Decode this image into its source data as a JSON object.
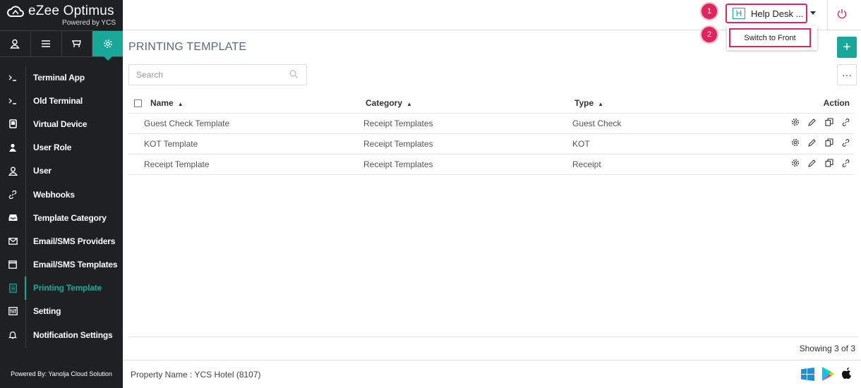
{
  "brand": {
    "name": "eZee Optimus",
    "powered": "Powered by YCS"
  },
  "iconbar": [
    {
      "icon": "user-icon"
    },
    {
      "icon": "list-icon"
    },
    {
      "icon": "cart-icon"
    },
    {
      "icon": "gear-icon",
      "active": true
    }
  ],
  "menu": [
    {
      "label": "Terminal App",
      "icon": "terminal-icon"
    },
    {
      "label": "Old Terminal",
      "icon": "terminal-icon"
    },
    {
      "label": "Virtual Device",
      "icon": "device-icon"
    },
    {
      "label": "User Role",
      "icon": "user-role-icon"
    },
    {
      "label": "User",
      "icon": "user-icon"
    },
    {
      "label": "Webhooks",
      "icon": "link-icon"
    },
    {
      "label": "Template Category",
      "icon": "tray-icon"
    },
    {
      "label": "Email/SMS Providers",
      "icon": "envelope-icon"
    },
    {
      "label": "Email/SMS Templates",
      "icon": "calendar-icon"
    },
    {
      "label": "Printing Template",
      "icon": "document-icon",
      "active": true
    },
    {
      "label": "Setting",
      "icon": "settings-icon"
    },
    {
      "label": "Notification Settings",
      "icon": "bell-icon"
    }
  ],
  "sidebar_footer": "Powered By: Yanolja Cloud Solution",
  "topbar": {
    "avatar_letter": "H",
    "user_name": "Help Desk ...",
    "dropdown_item": "Switch to Front",
    "badge1": "1",
    "badge2": "2"
  },
  "page": {
    "title": "PRINTING TEMPLATE",
    "add_label": "+",
    "more_label": "···",
    "search_placeholder": "Search"
  },
  "table": {
    "headers": {
      "name": "Name",
      "category": "Category",
      "type": "Type",
      "action": "Action"
    },
    "rows": [
      {
        "name": "Guest Check Template",
        "category": "Receipt Templates",
        "type": "Guest Check"
      },
      {
        "name": "KOT Template",
        "category": "Receipt Templates",
        "type": "KOT"
      },
      {
        "name": "Receipt Template",
        "category": "Receipt Templates",
        "type": "Receipt"
      }
    ]
  },
  "showing": "Showing 3 of 3",
  "property": "Property Name : YCS Hotel (8107)",
  "colors": {
    "accent": "#17a899",
    "highlight": "#e0245e",
    "sidebar": "#1e2022"
  }
}
